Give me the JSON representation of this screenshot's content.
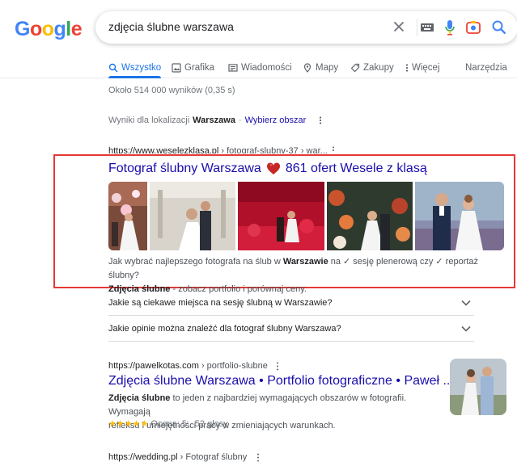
{
  "logo": {
    "letters": [
      "G",
      "o",
      "o",
      "g",
      "l",
      "e"
    ],
    "colors": [
      "#4285F4",
      "#EA4335",
      "#FBBC05",
      "#4285F4",
      "#34A853",
      "#EA4335"
    ]
  },
  "search": {
    "query": "zdjęcia ślubne warszawa"
  },
  "tabs": [
    {
      "label": "Wszystko",
      "icon": "search-icon",
      "active": true
    },
    {
      "label": "Grafika",
      "icon": "image-icon",
      "active": false
    },
    {
      "label": "Wiadomości",
      "icon": "news-icon",
      "active": false
    },
    {
      "label": "Mapy",
      "icon": "map-pin-icon",
      "active": false
    },
    {
      "label": "Zakupy",
      "icon": "tag-icon",
      "active": false
    },
    {
      "label": "Więcej",
      "icon": "more-vert-icon",
      "active": false
    },
    {
      "label": "Narzędzia",
      "icon": "",
      "active": false
    }
  ],
  "stats": "Około 514 000 wyników (0,35 s)",
  "locale": {
    "prefix": "Wyniki dla lokalizacji",
    "city": "Warszawa",
    "separator": "·",
    "action": "Wybierz obszar"
  },
  "results": [
    {
      "cite_host": "https://www.weselezklasa.pl",
      "cite_path": " › fotograf-slubny-37 › war...",
      "title_part1": "Fotograf ślubny Warszawa",
      "title_part2": "861 ofert Wesele z klasą",
      "snippet_l1_a": "Jak wybrać najlepszego fotografa na ślub w ",
      "snippet_l1_b": "Warszawie",
      "snippet_l1_c": " na ✓ sesję plenerową czy ✓ reportaż ślubny?",
      "snippet_l2_a": "Zdjęcia ślubne",
      "snippet_l2_b": " - zobacz portfolio i porównaj ceny."
    },
    {
      "cite_host": "https://pawelkotas.com",
      "cite_path": " › portfolio-slubne",
      "title": "Zdjęcia ślubne Warszawa • Portfolio fotograficzne • Paweł ...",
      "snippet_a": "Zdjęcia ślubne",
      "snippet_b": " to jeden z najbardziej wymagających obszarów w fotografii. Wymagają",
      "snippet_l2": "refleksu i umiejętności pracy w zmieniających warunkach.",
      "stars": "★★★★★",
      "rating": "Ocena: 5 · 52 głosy"
    },
    {
      "cite_host": "https://wedding.pl",
      "cite_path": " › Fotograf ślubny"
    }
  ],
  "paa": [
    "Jakie są ciekawe miejsca na sesję ślubną w Warszawie?",
    "Jakie opinie można znaleźć dla fotograf ślubny Warszawa?"
  ],
  "colors": {
    "link": "#1a0dab",
    "accent": "#1a73e8",
    "highlight": "#e53935",
    "star": "#fbbc04"
  }
}
